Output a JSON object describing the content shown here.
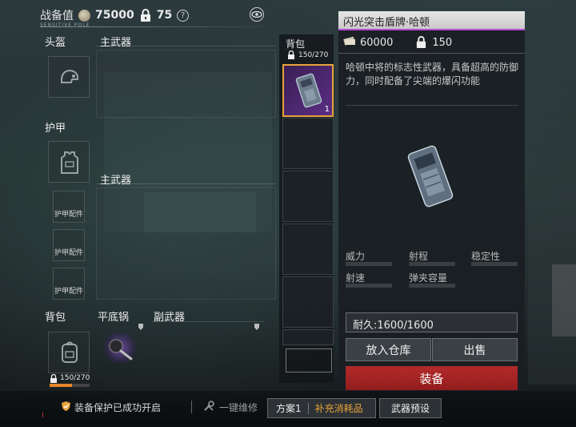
{
  "header": {
    "power_label": "战备值",
    "power_value": "75000",
    "lock_value": "75",
    "sub_caption": "SENSITIVE POLE"
  },
  "loadout": {
    "helmet_label": "头盔",
    "primary_weapon_1_label": "主武器",
    "armor_label": "护甲",
    "primary_weapon_2_label": "主武器",
    "armor_attachment_label": "护甲配件",
    "backpack_label": "背包",
    "pan_label": "平底锅",
    "secondary_weapon_label": "副武器",
    "backpack_capacity": "150/270"
  },
  "backpack_panel": {
    "title": "背包",
    "capacity": "150/270",
    "selected_item_count": "1"
  },
  "item_detail": {
    "title": "闪光突击盾牌·哈顿",
    "price": "60000",
    "lock_value": "150",
    "description": "哈顿中将的标志性武器，具备超高的防御力，同时配备了尖端的爆闪功能",
    "stats": {
      "power": "威力",
      "range": "射程",
      "stability": "稳定性",
      "fire_rate": "射速",
      "magazine": "弹夹容量"
    },
    "durability": "耐久:1600/1600",
    "store_button": "放入仓库",
    "sell_button": "出售",
    "equip_button": "装备",
    "rarity_color": "#b64ad6"
  },
  "bottom_bar": {
    "protection_text": "装备保护已成功开启",
    "repair_text": "一键维修",
    "plan_label": "方案1",
    "supply_label": "补充消耗品",
    "preset_label": "武器预设",
    "supply_color": "#e8a23a"
  }
}
